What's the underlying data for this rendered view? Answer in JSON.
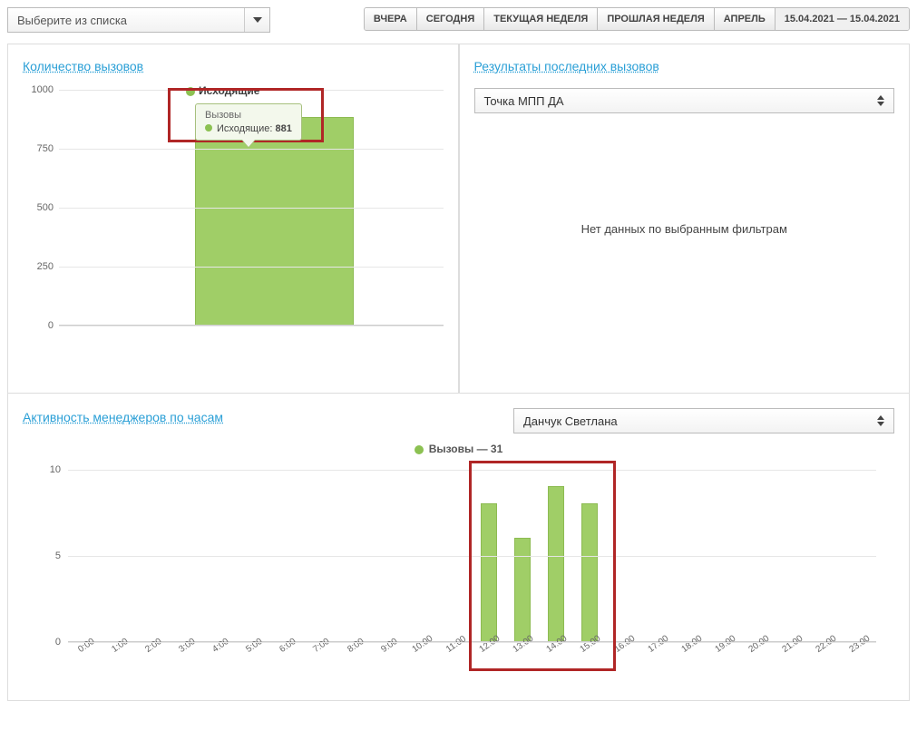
{
  "filter_dropdown": {
    "placeholder": "Выберите из списка"
  },
  "periods": {
    "items": [
      "ВЧЕРА",
      "СЕГОДНЯ",
      "ТЕКУЩАЯ НЕДЕЛЯ",
      "ПРОШЛАЯ НЕДЕЛЯ",
      "АПРЕЛЬ",
      "15.04.2021 — 15.04.2021"
    ],
    "active_index": 5
  },
  "panel_calls": {
    "title": "Количество вызовов",
    "legend_label": "Исходящие",
    "tooltip": {
      "title": "Вызовы",
      "series": "Исходящие",
      "value": "881"
    }
  },
  "panel_results": {
    "title": "Результаты последних вызовов",
    "select_value": "Точка МПП ДА",
    "no_data": "Нет данных по выбранным фильтрам"
  },
  "panel_activity": {
    "title": "Активность менеджеров по часам",
    "select_value": "Данчук Светлана",
    "legend_label": "Вызовы — 31"
  },
  "chart_data": [
    {
      "id": "calls",
      "type": "bar",
      "title": "Количество вызовов",
      "series": [
        {
          "name": "Исходящие",
          "values": [
            881
          ]
        }
      ],
      "categories": [
        "Вызовы"
      ],
      "ylabel": "",
      "xlabel": "",
      "ylim": [
        0,
        1000
      ],
      "yticks": [
        0,
        250,
        500,
        750,
        1000
      ]
    },
    {
      "id": "activity_by_hour",
      "type": "bar",
      "title": "Активность менеджеров по часам",
      "categories": [
        "0:00",
        "1:00",
        "2:00",
        "3:00",
        "4:00",
        "5:00",
        "6:00",
        "7:00",
        "8:00",
        "9:00",
        "10:00",
        "11:00",
        "12:00",
        "13:00",
        "14:00",
        "15:00",
        "16:00",
        "17:00",
        "18:00",
        "19:00",
        "20:00",
        "21:00",
        "22:00",
        "23:00"
      ],
      "series": [
        {
          "name": "Вызовы",
          "values": [
            0,
            0,
            0,
            0,
            0,
            0,
            0,
            0,
            0,
            0,
            0,
            0,
            8,
            6,
            9,
            8,
            0,
            0,
            0,
            0,
            0,
            0,
            0,
            0
          ]
        }
      ],
      "ylabel": "",
      "xlabel": "",
      "ylim": [
        0,
        10
      ],
      "yticks": [
        0,
        5,
        10
      ],
      "total": 31,
      "highlight_range": [
        12,
        16
      ]
    }
  ]
}
